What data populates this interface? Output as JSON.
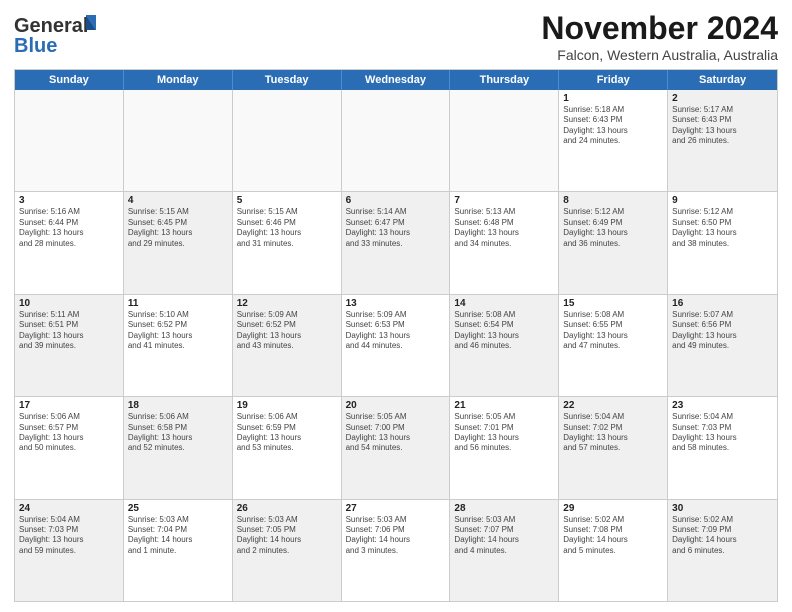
{
  "header": {
    "logo_general": "General",
    "logo_blue": "Blue",
    "title": "November 2024",
    "subtitle": "Falcon, Western Australia, Australia"
  },
  "weekdays": [
    "Sunday",
    "Monday",
    "Tuesday",
    "Wednesday",
    "Thursday",
    "Friday",
    "Saturday"
  ],
  "weeks": [
    [
      {
        "day": "",
        "info": "",
        "empty": true
      },
      {
        "day": "",
        "info": "",
        "empty": true
      },
      {
        "day": "",
        "info": "",
        "empty": true
      },
      {
        "day": "",
        "info": "",
        "empty": true
      },
      {
        "day": "",
        "info": "",
        "empty": true
      },
      {
        "day": "1",
        "info": "Sunrise: 5:18 AM\nSunset: 6:43 PM\nDaylight: 13 hours\nand 24 minutes.",
        "shaded": false
      },
      {
        "day": "2",
        "info": "Sunrise: 5:17 AM\nSunset: 6:43 PM\nDaylight: 13 hours\nand 26 minutes.",
        "shaded": true
      }
    ],
    [
      {
        "day": "3",
        "info": "Sunrise: 5:16 AM\nSunset: 6:44 PM\nDaylight: 13 hours\nand 28 minutes.",
        "shaded": false
      },
      {
        "day": "4",
        "info": "Sunrise: 5:15 AM\nSunset: 6:45 PM\nDaylight: 13 hours\nand 29 minutes.",
        "shaded": true
      },
      {
        "day": "5",
        "info": "Sunrise: 5:15 AM\nSunset: 6:46 PM\nDaylight: 13 hours\nand 31 minutes.",
        "shaded": false
      },
      {
        "day": "6",
        "info": "Sunrise: 5:14 AM\nSunset: 6:47 PM\nDaylight: 13 hours\nand 33 minutes.",
        "shaded": true
      },
      {
        "day": "7",
        "info": "Sunrise: 5:13 AM\nSunset: 6:48 PM\nDaylight: 13 hours\nand 34 minutes.",
        "shaded": false
      },
      {
        "day": "8",
        "info": "Sunrise: 5:12 AM\nSunset: 6:49 PM\nDaylight: 13 hours\nand 36 minutes.",
        "shaded": true
      },
      {
        "day": "9",
        "info": "Sunrise: 5:12 AM\nSunset: 6:50 PM\nDaylight: 13 hours\nand 38 minutes.",
        "shaded": false
      }
    ],
    [
      {
        "day": "10",
        "info": "Sunrise: 5:11 AM\nSunset: 6:51 PM\nDaylight: 13 hours\nand 39 minutes.",
        "shaded": true
      },
      {
        "day": "11",
        "info": "Sunrise: 5:10 AM\nSunset: 6:52 PM\nDaylight: 13 hours\nand 41 minutes.",
        "shaded": false
      },
      {
        "day": "12",
        "info": "Sunrise: 5:09 AM\nSunset: 6:52 PM\nDaylight: 13 hours\nand 43 minutes.",
        "shaded": true
      },
      {
        "day": "13",
        "info": "Sunrise: 5:09 AM\nSunset: 6:53 PM\nDaylight: 13 hours\nand 44 minutes.",
        "shaded": false
      },
      {
        "day": "14",
        "info": "Sunrise: 5:08 AM\nSunset: 6:54 PM\nDaylight: 13 hours\nand 46 minutes.",
        "shaded": true
      },
      {
        "day": "15",
        "info": "Sunrise: 5:08 AM\nSunset: 6:55 PM\nDaylight: 13 hours\nand 47 minutes.",
        "shaded": false
      },
      {
        "day": "16",
        "info": "Sunrise: 5:07 AM\nSunset: 6:56 PM\nDaylight: 13 hours\nand 49 minutes.",
        "shaded": true
      }
    ],
    [
      {
        "day": "17",
        "info": "Sunrise: 5:06 AM\nSunset: 6:57 PM\nDaylight: 13 hours\nand 50 minutes.",
        "shaded": false
      },
      {
        "day": "18",
        "info": "Sunrise: 5:06 AM\nSunset: 6:58 PM\nDaylight: 13 hours\nand 52 minutes.",
        "shaded": true
      },
      {
        "day": "19",
        "info": "Sunrise: 5:06 AM\nSunset: 6:59 PM\nDaylight: 13 hours\nand 53 minutes.",
        "shaded": false
      },
      {
        "day": "20",
        "info": "Sunrise: 5:05 AM\nSunset: 7:00 PM\nDaylight: 13 hours\nand 54 minutes.",
        "shaded": true
      },
      {
        "day": "21",
        "info": "Sunrise: 5:05 AM\nSunset: 7:01 PM\nDaylight: 13 hours\nand 56 minutes.",
        "shaded": false
      },
      {
        "day": "22",
        "info": "Sunrise: 5:04 AM\nSunset: 7:02 PM\nDaylight: 13 hours\nand 57 minutes.",
        "shaded": true
      },
      {
        "day": "23",
        "info": "Sunrise: 5:04 AM\nSunset: 7:03 PM\nDaylight: 13 hours\nand 58 minutes.",
        "shaded": false
      }
    ],
    [
      {
        "day": "24",
        "info": "Sunrise: 5:04 AM\nSunset: 7:03 PM\nDaylight: 13 hours\nand 59 minutes.",
        "shaded": true
      },
      {
        "day": "25",
        "info": "Sunrise: 5:03 AM\nSunset: 7:04 PM\nDaylight: 14 hours\nand 1 minute.",
        "shaded": false
      },
      {
        "day": "26",
        "info": "Sunrise: 5:03 AM\nSunset: 7:05 PM\nDaylight: 14 hours\nand 2 minutes.",
        "shaded": true
      },
      {
        "day": "27",
        "info": "Sunrise: 5:03 AM\nSunset: 7:06 PM\nDaylight: 14 hours\nand 3 minutes.",
        "shaded": false
      },
      {
        "day": "28",
        "info": "Sunrise: 5:03 AM\nSunset: 7:07 PM\nDaylight: 14 hours\nand 4 minutes.",
        "shaded": true
      },
      {
        "day": "29",
        "info": "Sunrise: 5:02 AM\nSunset: 7:08 PM\nDaylight: 14 hours\nand 5 minutes.",
        "shaded": false
      },
      {
        "day": "30",
        "info": "Sunrise: 5:02 AM\nSunset: 7:09 PM\nDaylight: 14 hours\nand 6 minutes.",
        "shaded": true
      }
    ]
  ]
}
